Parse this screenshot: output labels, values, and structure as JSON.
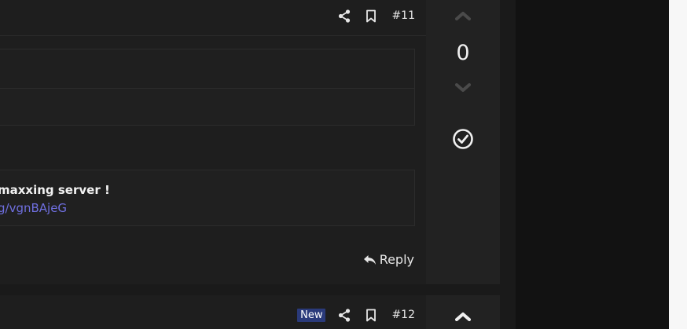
{
  "post11": {
    "number": "#11",
    "message_line1": "maxxing server !",
    "message_line2": "g/vgnBAjeG",
    "reply_label": "Reply",
    "vote_count": "0"
  },
  "post12": {
    "badge": "New",
    "number": "#12"
  },
  "icons": {
    "share": "share-icon",
    "bookmark": "bookmark-icon",
    "upvote": "chevron-up-icon",
    "downvote": "chevron-down-icon",
    "accept": "check-circle-icon",
    "reply": "reply-icon"
  },
  "colors": {
    "link": "#6f6fe0",
    "badge_bg": "#2a3a7a",
    "vote_inactive": "#4a4a4a"
  }
}
